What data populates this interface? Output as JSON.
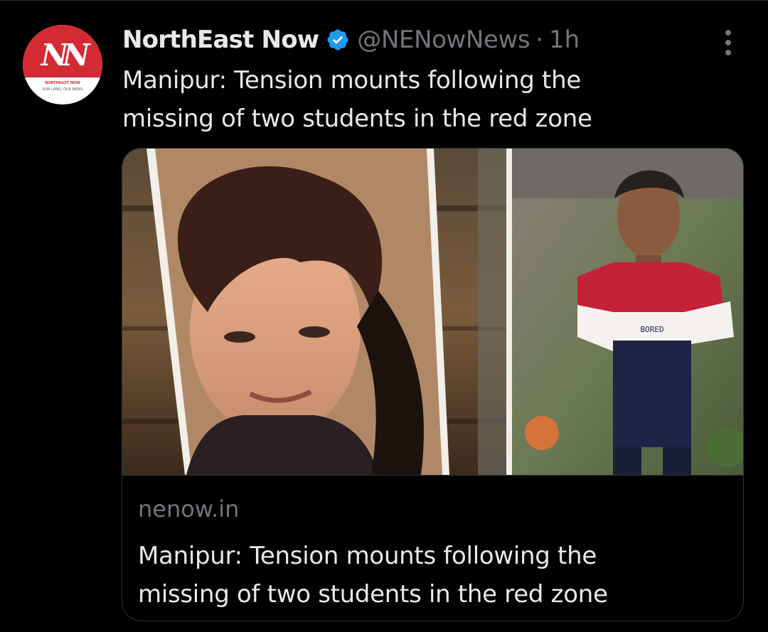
{
  "tweet": {
    "author": {
      "display_name": "NorthEast Now",
      "handle": "@NENowNews",
      "separator": "·",
      "time": "1h",
      "verified": true,
      "avatar": {
        "monogram": "NN",
        "name": "NORTHEAST NOW",
        "tagline": "OUR LAND. OUR NEWS"
      }
    },
    "text_lines": [
      "Manipur: Tension mounts following the",
      "missing of two students in the red zone"
    ],
    "card": {
      "domain": "nenow.in",
      "title_lines": [
        "Manipur: Tension mounts following the",
        "missing of two students in the red zone"
      ],
      "shirt_text": "BORED"
    }
  },
  "colors": {
    "background": "#000000",
    "text_primary": "#e7e9ea",
    "text_secondary": "#71767b",
    "border": "#2f3336",
    "verified_badge": "#1d9bf0",
    "brand_red": "#d42a34"
  },
  "icons": {
    "verified": "verified-badge-icon",
    "more": "more-options-icon"
  }
}
